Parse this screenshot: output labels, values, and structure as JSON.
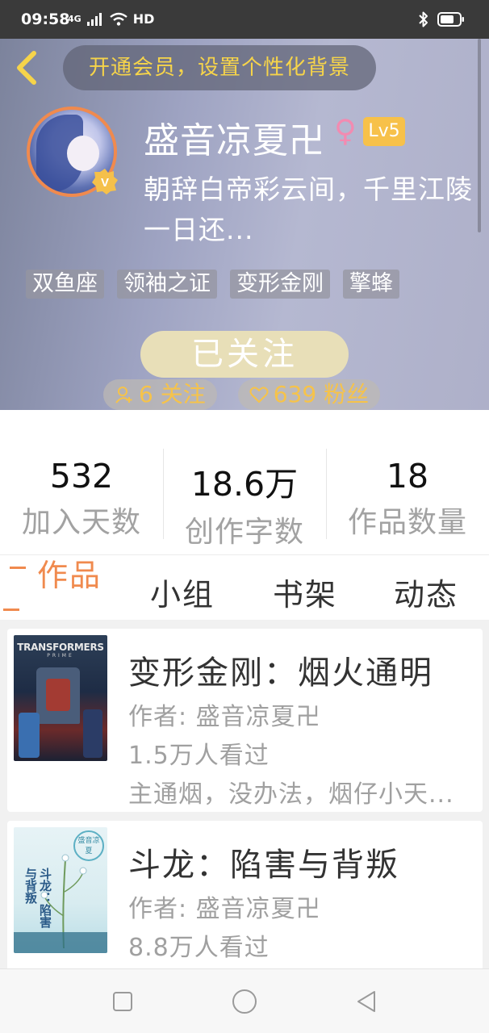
{
  "status_bar": {
    "time": "09:58",
    "network": "4G",
    "hd": "HD"
  },
  "header": {
    "vip_banner": "开通会员，设置个性化背景",
    "nickname": "盛音凉夏卍",
    "gender_symbol": "♀",
    "level": "Lv5",
    "bio": "朝辞白帝彩云间，千里江陵一日还...",
    "tags": [
      "双鱼座",
      "领袖之证",
      "变形金刚",
      "擎蜂"
    ],
    "follow_button": "已关注",
    "following_count": "6 关注",
    "fans_count": "639 粉丝"
  },
  "stats": [
    {
      "value": "532",
      "label": "加入天数"
    },
    {
      "value": "18.6万",
      "label": "创作字数"
    },
    {
      "value": "18",
      "label": "作品数量"
    }
  ],
  "tabs": [
    {
      "label": "作品",
      "active": true
    },
    {
      "label": "小组",
      "active": false
    },
    {
      "label": "书架",
      "active": false
    },
    {
      "label": "动态",
      "active": false
    }
  ],
  "works": [
    {
      "title": "变形金刚：烟火通明",
      "author": "作者: 盛音凉夏卍",
      "views": "1.5万人看过",
      "summary": "主通烟，没办法，烟仔小天...",
      "cover_text": "TRANSFORMERS",
      "cover_sub": "PRIME"
    },
    {
      "title": "斗龙：陷害与背叛",
      "author": "作者: 盛音凉夏卍",
      "views": "8.8万人看过",
      "cover_stamp": "盛音凉夏",
      "cover_calligraphy": "斗龙：陷害与背叛"
    }
  ],
  "colors": {
    "accent": "#f08a4e",
    "vip_text": "#f6d44a",
    "level_badge": "#f7c14a",
    "gender": "#f28bb1"
  }
}
